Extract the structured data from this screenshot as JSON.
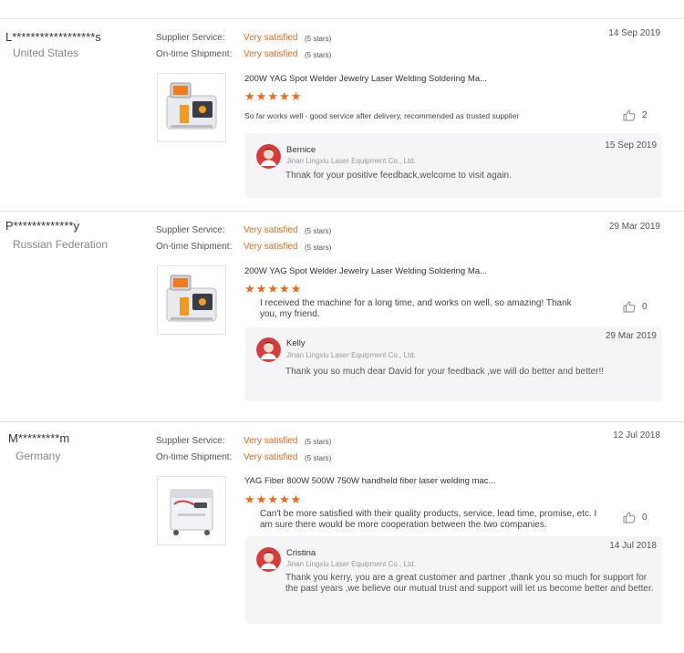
{
  "labels": {
    "supplier_service": "Supplier Service:",
    "ontime_shipment": "On-time Shipment:"
  },
  "colors": {
    "rating_accent": "#e66a1b",
    "star": "#f06a1d"
  },
  "reviews": [
    {
      "buyer": "L******************s",
      "country": "United States",
      "date": "14 Sep 2019",
      "supplier_rating": "Very satisfied",
      "supplier_stars": "(5 stars)",
      "shipment_rating": "Very satisfied",
      "shipment_stars": "(5 stars)",
      "product_title": "200W YAG Spot Welder Jewelry Laser Welding Soldering Ma...",
      "product_image_icon": "laser-spot-welder-image",
      "stars": 5,
      "comment": "So far works well - good service after delivery, recommended as trusted supplier",
      "likes": "2",
      "reply": {
        "name": "Bernice",
        "company": "Jinan Lingxiu Laser Equipment Co., Ltd.",
        "date": "15 Sep 2019",
        "text": "Thnak for your positive feedback,welcome to visit again."
      }
    },
    {
      "buyer": "P*************y",
      "country": "Russian Federation",
      "date": "29 Mar 2019",
      "supplier_rating": "Very satisfied",
      "supplier_stars": "(5 stars)",
      "shipment_rating": "Very satisfied",
      "shipment_stars": "(5 stars)",
      "product_title": "200W YAG Spot Welder Jewelry Laser Welding Soldering Ma...",
      "product_image_icon": "laser-spot-welder-image",
      "stars": 5,
      "comment": "I received the machine for a long time, and works on well, so amazing! Thank you, my friend.",
      "likes": "0",
      "reply": {
        "name": "Kelly",
        "company": "Jinan Lingxiu Laser Equipment Co., Ltd.",
        "date": "29 Mar 2019",
        "text": "Thank you so much dear David for your feedback ,we will do better and better!!"
      }
    },
    {
      "buyer": "M*********m",
      "country": "Germany",
      "date": "12 Jul 2018",
      "supplier_rating": "Very satisfied",
      "supplier_stars": "(5 stars)",
      "shipment_rating": "Very satisfied",
      "shipment_stars": "(5 stars)",
      "product_title": "YAG Fiber 800W 500W 750W handheld fiber laser welding mac...",
      "product_image_icon": "handheld-fiber-laser-welder-image",
      "stars": 5,
      "comment": "Can't be more satisfied with their quality products, service, lead time, promise, etc. I am sure there would be more cooperation between the two companies.",
      "likes": "0",
      "reply": {
        "name": "Cristina",
        "company": "Jinan Lingxiu Laser Equipment Co., Ltd.",
        "date": "14 Jul 2018",
        "text": "Thank you kerry, you are a great customer and partner ,thank you so much for support for the past years ,we believe our mutual trust and support will let us become better and better."
      }
    }
  ]
}
